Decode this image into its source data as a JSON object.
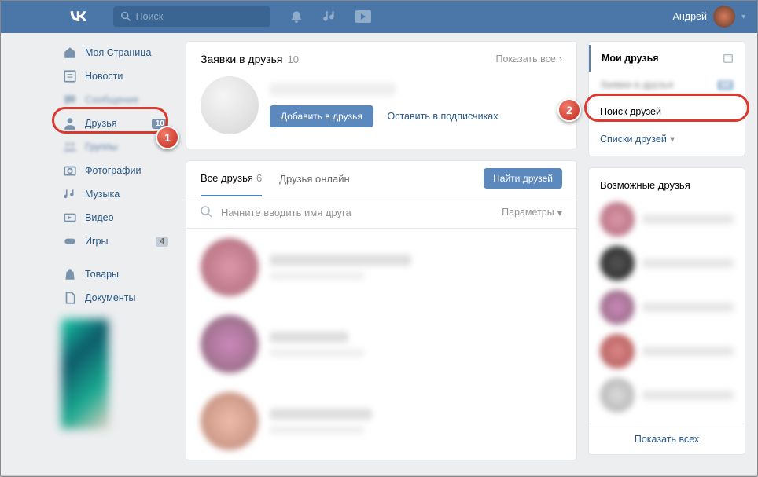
{
  "header": {
    "search_placeholder": "Поиск",
    "username": "Андрей"
  },
  "nav": {
    "my_page": "Моя Страница",
    "news": "Новости",
    "messages": "Сообщения",
    "friends": "Друзья",
    "friends_count": "10",
    "groups": "Группы",
    "photos": "Фотографии",
    "music": "Музыка",
    "videos": "Видео",
    "games": "Игры",
    "games_count": "4",
    "goods": "Товары",
    "documents": "Документы"
  },
  "requests": {
    "title": "Заявки в друзья",
    "count": "10",
    "show_all": "Показать все",
    "add_friend": "Добавить в друзья",
    "leave_sub": "Оставить в подписчиках"
  },
  "tabs": {
    "all": "Все друзья",
    "all_count": "6",
    "online": "Друзья онлайн",
    "find": "Найти друзей"
  },
  "search": {
    "placeholder": "Начните вводить имя друга",
    "params": "Параметры"
  },
  "rightnav": {
    "my_friends": "Мои друзья",
    "requests": "Заявки в друзья",
    "find": "Поиск друзей",
    "lists": "Списки друзей"
  },
  "possible": {
    "title": "Возможные друзья",
    "show_all": "Показать всех"
  },
  "annotations": {
    "n1": "1",
    "n2": "2"
  }
}
